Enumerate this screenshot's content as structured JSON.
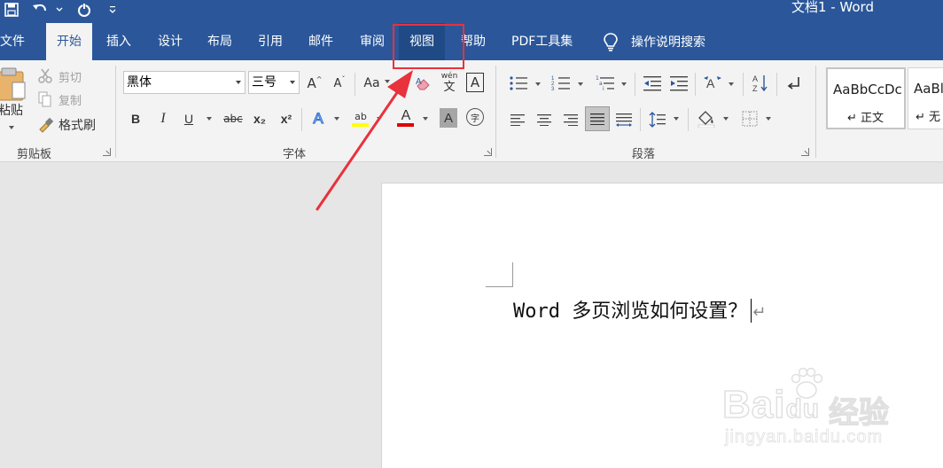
{
  "titlebar": {
    "doc_title": "文档1  -  Word"
  },
  "tabs": [
    {
      "label": "文件"
    },
    {
      "label": "开始"
    },
    {
      "label": "插入"
    },
    {
      "label": "设计"
    },
    {
      "label": "布局"
    },
    {
      "label": "引用"
    },
    {
      "label": "邮件"
    },
    {
      "label": "审阅"
    },
    {
      "label": "视图"
    },
    {
      "label": "帮助"
    },
    {
      "label": "PDF工具集"
    }
  ],
  "tell_me": {
    "label": "操作说明搜索",
    "icon": "lightbulb-icon"
  },
  "clipboard": {
    "paste": "粘贴",
    "cut": "剪切",
    "copy": "复制",
    "format_painter": "格式刷",
    "group_label": "剪贴板"
  },
  "font": {
    "font_name": "黑体",
    "font_size": "三号",
    "group_label": "字体",
    "case_label": "Aa",
    "phonetic_top": "wén",
    "phonetic_bottom": "文",
    "border_char": "A",
    "bold": "B",
    "italic": "I",
    "underline": "U",
    "strike": "abc",
    "subscript": "x₂",
    "superscript": "x²",
    "effects": "A",
    "highlight_text": "ab",
    "font_color": "A",
    "shading": "A",
    "enclosed": "字",
    "grow": "A",
    "shrink": "A",
    "highlight_color": "#ffff00",
    "font_color_value": "#e00000"
  },
  "paragraph": {
    "group_label": "段落"
  },
  "styles": [
    {
      "sample": "AaBbCcDc",
      "name": "↵ 正文"
    },
    {
      "sample": "AaBl",
      "name": "↵ 无"
    }
  ],
  "document": {
    "text": "Word 多页浏览如何设置？",
    "para_mark": "↵"
  },
  "watermark": {
    "logo": "Bai",
    "logo2": "du",
    "cn": "经验",
    "url": "jingyan.baidu.com"
  }
}
